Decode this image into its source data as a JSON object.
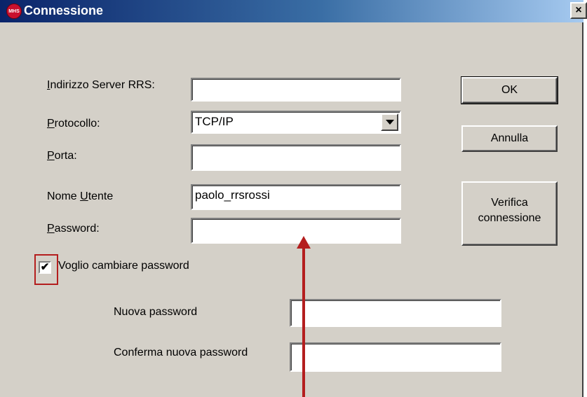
{
  "window": {
    "title": "Connessione",
    "icon_name": "mhs-app-icon",
    "icon_text": "MHS",
    "close_label": "×"
  },
  "form": {
    "server": {
      "label_hot": "I",
      "label_rest": "ndirizzo Server RRS:",
      "value": ""
    },
    "protocol": {
      "label_hot": "P",
      "label_rest": "rotocollo:",
      "value": "TCP/IP"
    },
    "port": {
      "label_hot": "P",
      "label_rest": "orta:",
      "value": ""
    },
    "username": {
      "label_pre": "Nome ",
      "label_hot": "U",
      "label_rest": "tente",
      "value": "paolo_rrsrossi"
    },
    "password": {
      "label_hot": "P",
      "label_rest": "assword:",
      "value": ""
    },
    "change_password": {
      "checked": true,
      "check_mark": "✔",
      "label": "Voglio cambiare password"
    },
    "new_password": {
      "label": "Nuova password",
      "value": ""
    },
    "confirm_password": {
      "label": "Conferma nuova password",
      "value": ""
    }
  },
  "buttons": {
    "ok": "OK",
    "cancel": "Annulla",
    "verify_line1": "Verifica",
    "verify_line2": "connessione"
  },
  "annotation": {
    "color": "#b41e1e"
  }
}
